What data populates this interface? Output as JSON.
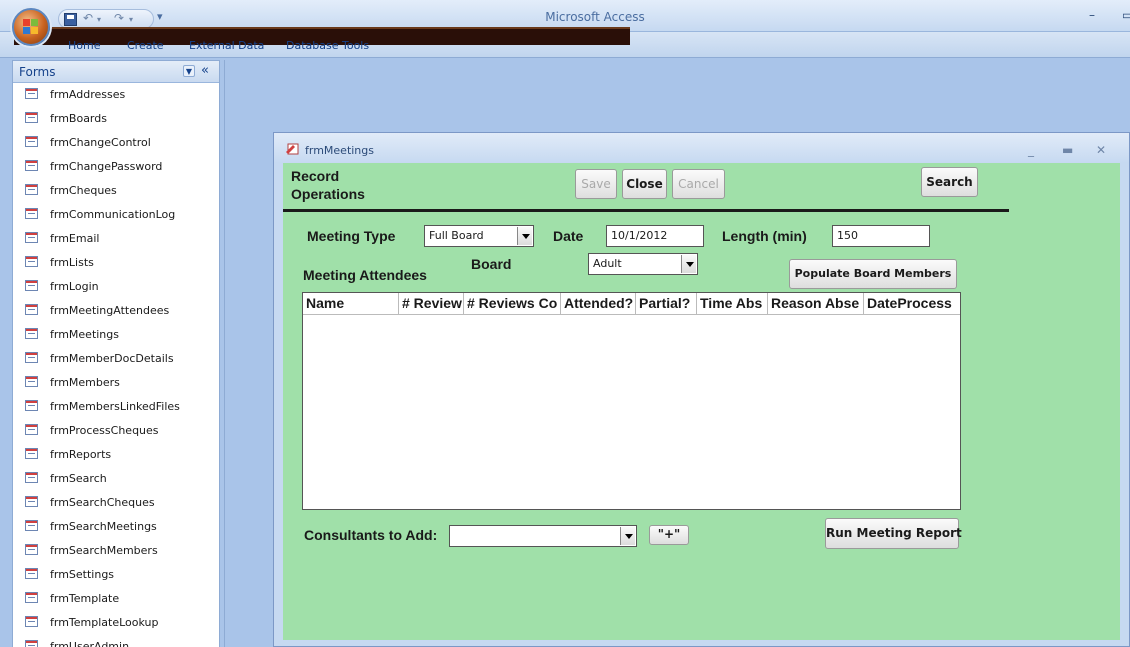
{
  "app": {
    "title": "Microsoft Access",
    "ribbon_tabs": [
      "Home",
      "Create",
      "External Data",
      "Database Tools"
    ]
  },
  "nav": {
    "header": "Forms",
    "items": [
      "frmAddresses",
      "frmBoards",
      "frmChangeControl",
      "frmChangePassword",
      "frmCheques",
      "frmCommunicationLog",
      "frmEmail",
      "frmLists",
      "frmLogin",
      "frmMeetingAttendees",
      "frmMeetings",
      "frmMemberDocDetails",
      "frmMembers",
      "frmMembersLinkedFiles",
      "frmProcessCheques",
      "frmReports",
      "frmSearch",
      "frmSearchCheques",
      "frmSearchMeetings",
      "frmSearchMembers",
      "frmSettings",
      "frmTemplate",
      "frmTemplateLookup",
      "frmUserAdmin"
    ]
  },
  "form": {
    "title": "frmMeetings",
    "record_ops_line1": "Record",
    "record_ops_line2": "Operations",
    "save": "Save",
    "close": "Close",
    "cancel": "Cancel",
    "search": "Search",
    "meeting_type_label": "Meeting Type",
    "meeting_type_value": "Full Board",
    "date_label": "Date",
    "date_value": "10/1/2012",
    "length_label": "Length (min)",
    "length_value": "150",
    "attendees_label": "Meeting Attendees",
    "board_label": "Board",
    "board_value": "Adult",
    "populate": "Populate Board Members",
    "columns": [
      "Name",
      "# Review",
      "# Reviews Co",
      "Attended?",
      "Partial?",
      "Time Abs",
      "Reason Abse",
      "DateProcess"
    ],
    "consultants_label": "Consultants to Add:",
    "consultants_value": "",
    "add_button": "\"+\"",
    "run_report": "Run Meeting Report"
  },
  "colors": {
    "form_bg": "#a0e0a9",
    "workspace_bg": "#a9c4e9"
  }
}
